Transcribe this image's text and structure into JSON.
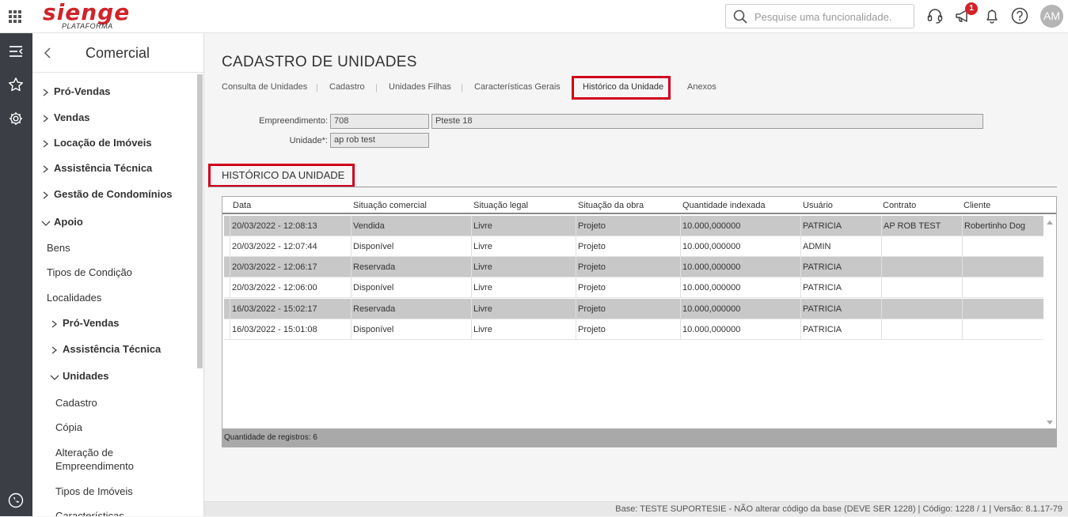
{
  "header": {
    "logo_text": "sienge",
    "logo_sub": "PLATAFORMA",
    "search_placeholder": "Pesquise uma funcionalidade.",
    "notification_count": "1",
    "avatar_initials": "AM"
  },
  "sidebar": {
    "title": "Comercial",
    "items": [
      {
        "label": "Pró-Vendas"
      },
      {
        "label": "Vendas"
      },
      {
        "label": "Locação de Imóveis"
      },
      {
        "label": "Assistência Técnica"
      },
      {
        "label": "Gestão de Condomínios"
      },
      {
        "label": "Apoio"
      },
      {
        "label": "Bens"
      },
      {
        "label": "Tipos de Condição"
      },
      {
        "label": "Localidades"
      },
      {
        "label": "Pró-Vendas"
      },
      {
        "label": "Assistência Técnica"
      },
      {
        "label": "Unidades"
      },
      {
        "label": "Cadastro"
      },
      {
        "label": "Cópia"
      },
      {
        "label": "Alteração de"
      },
      {
        "label": "Empreendimento"
      },
      {
        "label": "Tipos de Imóveis"
      },
      {
        "label": "Características"
      }
    ]
  },
  "page": {
    "title": "CADASTRO DE UNIDADES",
    "tabs": [
      {
        "label": "Consulta de Unidades"
      },
      {
        "label": "Cadastro"
      },
      {
        "label": "Unidades Filhas"
      },
      {
        "label": "Características Gerais"
      },
      {
        "label": "Histórico da Unidade"
      },
      {
        "label": "Anexos"
      }
    ],
    "tab_separator": "|",
    "fields": {
      "empreendimento_label": "Empreendimento:",
      "empreendimento_code": "708",
      "empreendimento_name": "Pteste 18",
      "unidade_label": "Unidade*:",
      "unidade_value": "ap rob test"
    },
    "section_title": "HISTÓRICO DA UNIDADE"
  },
  "table": {
    "columns": [
      "Data",
      "Situação comercial",
      "Situação legal",
      "Situação da obra",
      "Quantidade indexada",
      "Usuário",
      "Contrato",
      "Cliente"
    ],
    "rows": [
      [
        "20/03/2022 -  12:08:13",
        "Vendida",
        "Livre",
        "Projeto",
        "10.000,000000",
        "PATRICIA",
        "AP ROB TEST",
        "Robertinho Dog"
      ],
      [
        "20/03/2022 -  12:07:44",
        "Disponível",
        "Livre",
        "Projeto",
        "10.000,000000",
        "ADMIN",
        "",
        ""
      ],
      [
        "20/03/2022 -  12:06:17",
        "Reservada",
        "Livre",
        "Projeto",
        "10.000,000000",
        "PATRICIA",
        "",
        ""
      ],
      [
        "20/03/2022 -  12:06:00",
        "Disponível",
        "Livre",
        "Projeto",
        "10.000,000000",
        "PATRICIA",
        "",
        ""
      ],
      [
        "16/03/2022 -  15:02:17",
        "Reservada",
        "Livre",
        "Projeto",
        "10.000,000000",
        "PATRICIA",
        "",
        ""
      ],
      [
        "16/03/2022 -  15:01:08",
        "Disponível",
        "Livre",
        "Projeto",
        "10.000,000000",
        "PATRICIA",
        "",
        ""
      ]
    ],
    "footer": "Quantidade de registros: 6"
  },
  "statusbar": {
    "text": "Base: TESTE SUPORTESIE - NÃO alterar código da base (DEVE SER 1228)  |  Código: 1228 / 1  |  Versão: 8.1.17-79"
  },
  "colors": {
    "brand": "#d2232a",
    "highlight_box": "#d0001b",
    "rail": "#3b3f45",
    "row_alt": "#c8c8c8"
  }
}
